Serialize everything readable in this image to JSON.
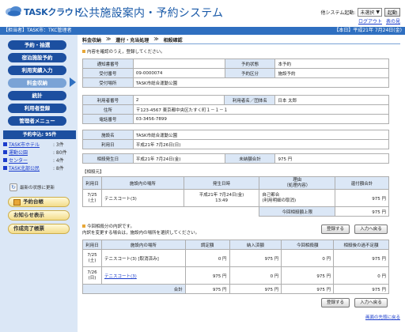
{
  "header": {
    "logo_text": "TASKクラウド",
    "title": "公共施設案内・予約システム",
    "switch_label": "他システム起動:",
    "switch_value": "未選択",
    "switch_button": "起動",
    "logout": "ログアウト",
    "help": "表の見"
  },
  "bar": {
    "left": "【担当者】TASK市：TKC管理者",
    "right": "【本日】平成21年 7月24日(金)"
  },
  "sidebar": {
    "nav": [
      "予約・抽選",
      "宿泊施設予約",
      "利用実績入力",
      "料金収納",
      "統計",
      "利用者登録",
      "管理者メニュー"
    ],
    "apply_head": "予約申込: 95件",
    "apply_items": [
      {
        "name": "TASK市ホテル",
        "count": ": 3件"
      },
      {
        "name": "運動公園",
        "count": ": 80件"
      },
      {
        "name": "センター",
        "count": ": 4件"
      },
      {
        "name": "TASK北部公民",
        "count": ": 8件"
      }
    ],
    "refresh": "最新の状態に更新",
    "pills": [
      "予約台帳",
      "お知らせ表示",
      "作成完了帳票"
    ]
  },
  "crumb": [
    "料金収納",
    "≫",
    "還付・充当処理",
    "≫",
    "相殺確認"
  ],
  "note1": "内容を確認のうえ，登録してください。",
  "reservation": {
    "labels": {
      "notice_no": "通知書番号",
      "status": "予約状態",
      "receipt_no": "受付番号",
      "category": "予約区分",
      "place": "受付場所"
    },
    "notice_no": "",
    "status": "本予約",
    "receipt_no": "09-0000074",
    "category": "施設予約",
    "place": "TASK市総合運動公園"
  },
  "user": {
    "labels": {
      "user_no": "利用者番号",
      "name": "利用者名／団体名",
      "address": "住所",
      "phone": "電話番号"
    },
    "user_no": "2",
    "name": "日本 太郎",
    "address": "〒123-4567 東京都中央区たすく町１－１－１",
    "phone": "03-3456-7899"
  },
  "facility": {
    "labels": {
      "facility": "施設名",
      "date": "利用日"
    },
    "facility": "TASK市総合運動公園",
    "date": "平成21年 7月26日(日)"
  },
  "offset": {
    "labels": {
      "date": "相殺発生日",
      "unpaid": "未納額合計"
    },
    "date": "平成21年 7月24日(金)",
    "unpaid": "975 円"
  },
  "source": {
    "title": "【相殺元】",
    "headers": [
      "利用日",
      "施設内の場所",
      "発生日時",
      "理由\n（処理内容）",
      "還付額合計"
    ],
    "row": {
      "date": "7/25\n(土)",
      "place": "テニスコート(3)",
      "when": "平成21年 7月24日(金)\n13:49",
      "reason": "自己都合\n(利用明細の取消)",
      "amount": "975 円"
    },
    "limit_label": "今回相殺額上限",
    "limit_value": "975 円"
  },
  "note2": "今回相殺分の内訳です。",
  "note3": "内訳を変更する場合は，施設内の場所を選択してください。",
  "buttons": {
    "register": "登録する",
    "back": "入力へ戻る"
  },
  "detail": {
    "headers": [
      "利用日",
      "施設内の場所",
      "調定額",
      "納入済額",
      "今回相殺額",
      "相殺後の過不足額"
    ],
    "rows": [
      {
        "date": "7/25\n(土)",
        "place": "テニスコート(3) [取消済み]",
        "charge": "0 円",
        "paid": "975 円",
        "offset": "0 円",
        "balance": "975 円"
      },
      {
        "date": "7/26\n(日)",
        "place": "テニスコート(3)",
        "charge": "975 円",
        "paid": "0 円",
        "offset": "975 円",
        "balance": "0 円"
      }
    ],
    "total_label": "合計",
    "total": {
      "charge": "975 円",
      "paid": "975 円",
      "offset": "975 円",
      "balance": "975 円"
    }
  },
  "footer_link": "画面の先頭に戻る",
  "colors": {
    "accent": "#2f6fc0",
    "nav": "#1c4fa0",
    "label_bg": "#dbe7f6"
  }
}
